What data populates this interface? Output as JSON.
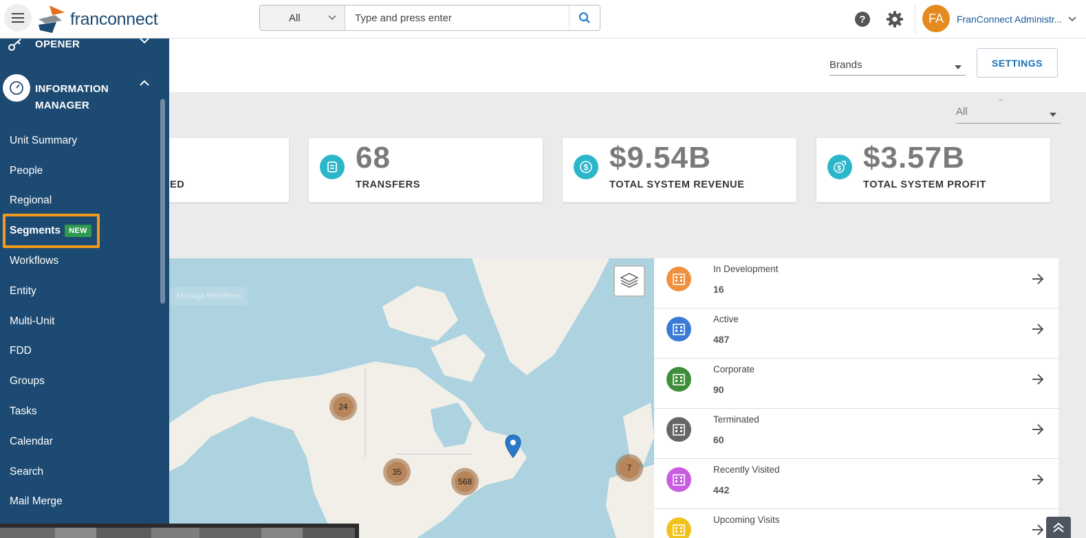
{
  "topbar": {
    "logo_text": "franconnect",
    "search_scope": "All",
    "search_placeholder": "Type and press enter",
    "user_initials": "FA",
    "user_name": "FranConnect Administr..."
  },
  "sidebar": {
    "opener_label": "OPENER",
    "section_label": "INFORMATION MANAGER",
    "items": [
      {
        "label": "Unit Summary"
      },
      {
        "label": "People"
      },
      {
        "label": "Regional"
      },
      {
        "label": "Segments",
        "badge": "NEW"
      },
      {
        "label": "Workflows"
      },
      {
        "label": "Entity"
      },
      {
        "label": "Multi-Unit"
      },
      {
        "label": "FDD"
      },
      {
        "label": "Groups"
      },
      {
        "label": "Tasks"
      },
      {
        "label": "Calendar"
      },
      {
        "label": "Search"
      },
      {
        "label": "Mail Merge"
      }
    ]
  },
  "header": {
    "brands_label": "Brands",
    "settings_label": "SETTINGS",
    "filter_value": "All"
  },
  "kpis": [
    {
      "value": "",
      "label": "ED"
    },
    {
      "value": "68",
      "label": "TRANSFERS"
    },
    {
      "value": "$9.54B",
      "label": "TOTAL SYSTEM REVENUE"
    },
    {
      "value": "$3.57B",
      "label": "TOTAL SYSTEM PROFIT"
    }
  ],
  "map": {
    "manage_workflows": "Manage Workflows",
    "clusters": [
      "24",
      "35",
      "568",
      "7"
    ]
  },
  "status": [
    {
      "label": "In Development",
      "count": "16",
      "color": "#f0913f"
    },
    {
      "label": "Active",
      "count": "487",
      "color": "#3b7bd6"
    },
    {
      "label": "Corporate",
      "count": "90",
      "color": "#3e8e3a"
    },
    {
      "label": "Terminated",
      "count": "60",
      "color": "#666666"
    },
    {
      "label": "Recently Visited",
      "count": "442",
      "color": "#c85de0"
    },
    {
      "label": "Upcoming Visits",
      "count": "",
      "color": "#f2c21c"
    }
  ]
}
